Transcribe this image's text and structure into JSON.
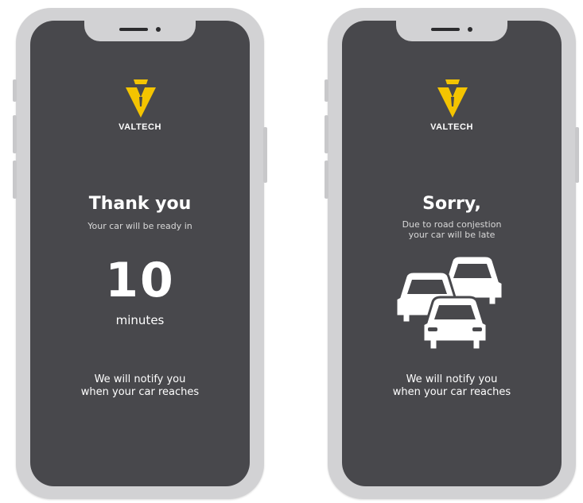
{
  "colors": {
    "screen_bg": "#48484c",
    "phone_frame": "#d2d2d4",
    "brand_yellow": "#f4c400",
    "text": "#ffffff"
  },
  "screens": [
    {
      "brand": "VALTECH",
      "title": "Thank you",
      "subtitle": [
        "Your car will be ready in"
      ],
      "countdown_value": "10",
      "countdown_unit": "minutes",
      "notify": [
        "We will notify you",
        "when your car reaches"
      ]
    },
    {
      "brand": "VALTECH",
      "title": "Sorry,",
      "subtitle": [
        "Due to road conjestion",
        "your car will be late"
      ],
      "illustration": "traffic-jam-cars-icon",
      "notify": [
        "We will notify you",
        "when your car reaches"
      ]
    }
  ]
}
